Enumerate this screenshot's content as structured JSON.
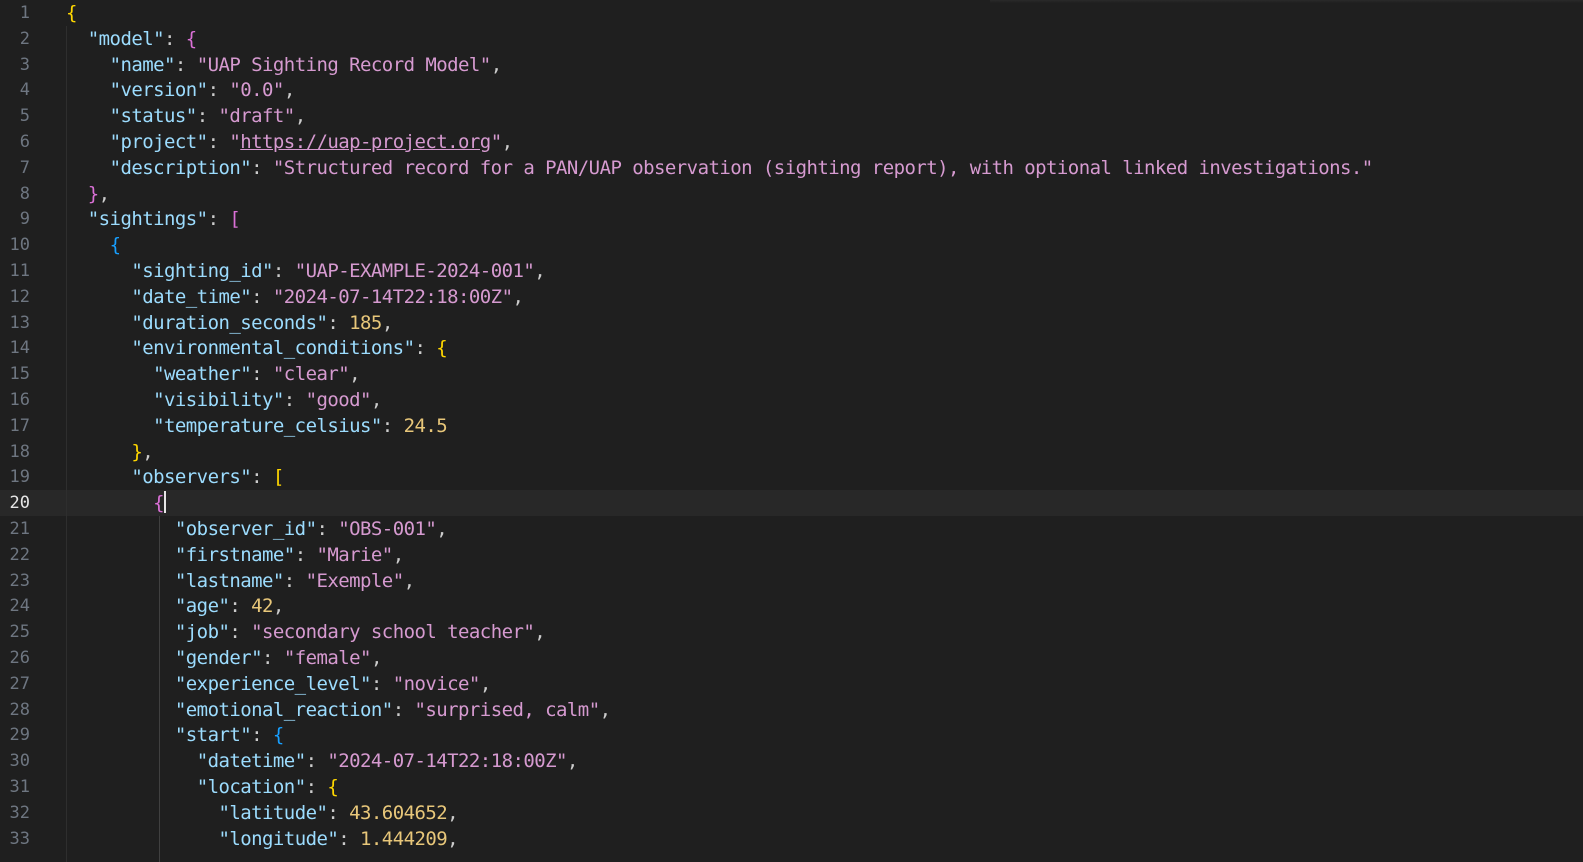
{
  "editor": {
    "current_line": 20,
    "lines": [
      {
        "n": "1",
        "t": "{"
      },
      {
        "n": "2",
        "t": "  \"model\": {"
      },
      {
        "n": "3",
        "t": "    \"name\": \"UAP Sighting Record Model\","
      },
      {
        "n": "4",
        "t": "    \"version\": \"0.0\","
      },
      {
        "n": "5",
        "t": "    \"status\": \"draft\","
      },
      {
        "n": "6",
        "t": "    \"project\": \"https://uap-project.org\","
      },
      {
        "n": "7",
        "t": "    \"description\": \"Structured record for a PAN/UAP observation (sighting report), with optional linked investigations.\""
      },
      {
        "n": "8",
        "t": "  },"
      },
      {
        "n": "9",
        "t": "  \"sightings\": ["
      },
      {
        "n": "10",
        "t": "    {"
      },
      {
        "n": "11",
        "t": "      \"sighting_id\": \"UAP-EXAMPLE-2024-001\","
      },
      {
        "n": "12",
        "t": "      \"date_time\": \"2024-07-14T22:18:00Z\","
      },
      {
        "n": "13",
        "t": "      \"duration_seconds\": 185,"
      },
      {
        "n": "14",
        "t": "      \"environmental_conditions\": {"
      },
      {
        "n": "15",
        "t": "        \"weather\": \"clear\","
      },
      {
        "n": "16",
        "t": "        \"visibility\": \"good\","
      },
      {
        "n": "17",
        "t": "        \"temperature_celsius\": 24.5"
      },
      {
        "n": "18",
        "t": "      },"
      },
      {
        "n": "19",
        "t": "      \"observers\": ["
      },
      {
        "n": "20",
        "t": "        {"
      },
      {
        "n": "21",
        "t": "          \"observer_id\": \"OBS-001\","
      },
      {
        "n": "22",
        "t": "          \"firstname\": \"Marie\","
      },
      {
        "n": "23",
        "t": "          \"lastname\": \"Exemple\","
      },
      {
        "n": "24",
        "t": "          \"age\": 42,"
      },
      {
        "n": "25",
        "t": "          \"job\": \"secondary school teacher\","
      },
      {
        "n": "26",
        "t": "          \"gender\": \"female\","
      },
      {
        "n": "27",
        "t": "          \"experience_level\": \"novice\","
      },
      {
        "n": "28",
        "t": "          \"emotional_reaction\": \"surprised, calm\","
      },
      {
        "n": "29",
        "t": "          \"start\": {"
      },
      {
        "n": "30",
        "t": "            \"datetime\": \"2024-07-14T22:18:00Z\","
      },
      {
        "n": "31",
        "t": "            \"location\": {"
      },
      {
        "n": "32",
        "t": "              \"latitude\": 43.604652,"
      },
      {
        "n": "33",
        "t": "              \"longitude\": 1.444209,"
      }
    ]
  },
  "colors": {
    "background": "#1f1f1f",
    "current_line_bg": "#282828",
    "key": "#9cdcfe",
    "string": "#d69ad0",
    "number": "#e8c77a",
    "bracket_gold": "#ffd700",
    "bracket_orchid": "#da70d6",
    "bracket_blue": "#179fff"
  }
}
